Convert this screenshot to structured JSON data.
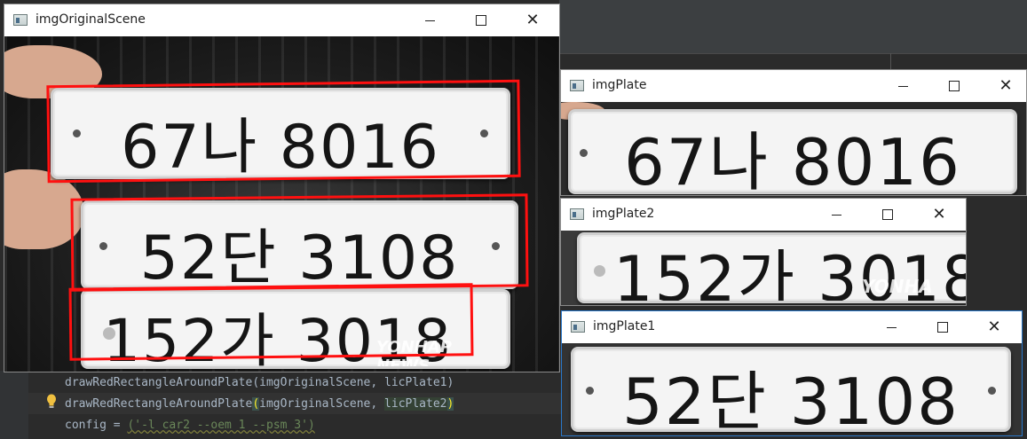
{
  "windows": {
    "original": {
      "title": "imgOriginalScene"
    },
    "plate": {
      "title": "imgPlate"
    },
    "plate2": {
      "title": "imgPlate2"
    },
    "plate1": {
      "title": "imgPlate1"
    }
  },
  "plates": {
    "top": "67나 8016",
    "middle": "52단 3108",
    "bottom": "152가 3018"
  },
  "watermark": "YONHAP NEWS",
  "watermark_short": "YONHA",
  "code": {
    "line1": "drawRedRectangleAroundPlate(imgOriginalScene, licPlate1)",
    "line2_fn": "drawRedRectangleAroundPlate",
    "line2_open": "(",
    "line2_mid": "imgOriginalScene, ",
    "line2_var": "licPlate2",
    "line2_close": ")",
    "line3_prefix": "config = ",
    "line3_str": "('-l car2 --oem 1 --psm 3')"
  },
  "controls": {
    "minimize": "—",
    "maximize": "☐",
    "close": "✕"
  },
  "colors": {
    "highlight": "#ff1010",
    "accent": "#2a78c9"
  }
}
